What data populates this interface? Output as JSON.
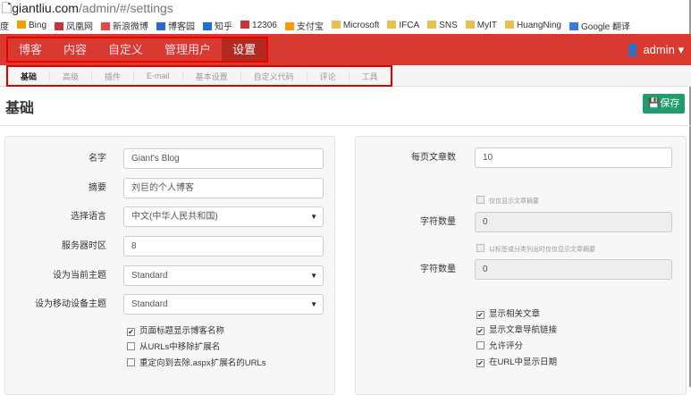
{
  "browser": {
    "domain": "giantliu.com",
    "path": "/admin/#/settings"
  },
  "bookmarks": [
    "度",
    "Bing",
    "凤凰网",
    "新浪微博",
    "博客园",
    "知乎",
    "12306",
    "支付宝",
    "Microsoft",
    "IFCA",
    "SNS",
    "MyIT",
    "HuangNing",
    "Google 翻译"
  ],
  "nav": {
    "items": [
      "博客",
      "内容",
      "自定义",
      "管理用户",
      "设置"
    ],
    "user": "admin"
  },
  "subnav": [
    "基础",
    "高级",
    "插件",
    "E-mail",
    "基本设置",
    "自定义代码",
    "评论",
    "工具"
  ],
  "page": {
    "title": "基础",
    "save": "保存"
  },
  "left": {
    "name_label": "名字",
    "name": "Giant's Blog",
    "desc_label": "摘要",
    "desc": "刘巨的个人博客",
    "lang_label": "选择语言",
    "lang": "中文(中华人民共和国)",
    "tz_label": "服务器时区",
    "tz": "8",
    "theme_label": "设为当前主题",
    "theme": "Standard",
    "mtheme_label": "设为移动设备主题",
    "mtheme": "Standard",
    "checks": [
      {
        "label": "页面标题显示博客名称",
        "checked": true
      },
      {
        "label": "从URLs中移除扩展名",
        "checked": false
      },
      {
        "label": "重定向到去除.aspx扩展名的URLs",
        "checked": false
      }
    ]
  },
  "right": {
    "ppp_label": "每页文章数",
    "ppp": "10",
    "sum1": "仅仅显示文章摘要",
    "cc1_label": "字符数量",
    "cc1": "0",
    "sum2": "以标签或分类列出时仅仅显示文章摘要",
    "cc2_label": "字符数量",
    "cc2": "0",
    "checks": [
      {
        "label": "显示相关文章",
        "checked": true
      },
      {
        "label": "显示文章导航链接",
        "checked": true
      },
      {
        "label": "允许评分",
        "checked": false
      },
      {
        "label": "在URL中显示日期",
        "checked": true
      }
    ]
  }
}
